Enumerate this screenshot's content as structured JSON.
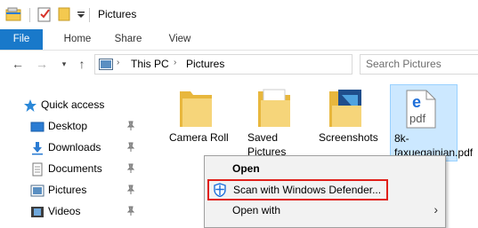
{
  "window": {
    "title": "Pictures"
  },
  "ribbon": {
    "tabs": [
      "File",
      "Home",
      "Share",
      "View"
    ]
  },
  "address": {
    "crumbs": [
      "This PC",
      "Pictures"
    ],
    "search_placeholder": "Search Pictures"
  },
  "navpane": {
    "items": [
      {
        "label": "Quick access",
        "icon": "star-icon",
        "pinned": false
      },
      {
        "label": "Desktop",
        "icon": "desktop-icon",
        "pinned": true
      },
      {
        "label": "Downloads",
        "icon": "download-icon",
        "pinned": true
      },
      {
        "label": "Documents",
        "icon": "documents-icon",
        "pinned": true
      },
      {
        "label": "Pictures",
        "icon": "pictures-icon",
        "pinned": true
      },
      {
        "label": "Videos",
        "icon": "videos-icon",
        "pinned": true
      }
    ]
  },
  "files": [
    {
      "label": "Camera Roll",
      "type": "folder"
    },
    {
      "label": "Saved Pictures",
      "type": "folder"
    },
    {
      "label": "Screenshots",
      "type": "folder"
    },
    {
      "label": "8k-faxuegainian.pdf",
      "type": "pdf",
      "selected": true
    }
  ],
  "context_menu": {
    "open": "Open",
    "scan": "Scan with Windows Defender...",
    "open_with": "Open with"
  },
  "colors": {
    "accent": "#1979ca",
    "selection": "#cce8ff",
    "highlight_border": "#e0201a"
  }
}
